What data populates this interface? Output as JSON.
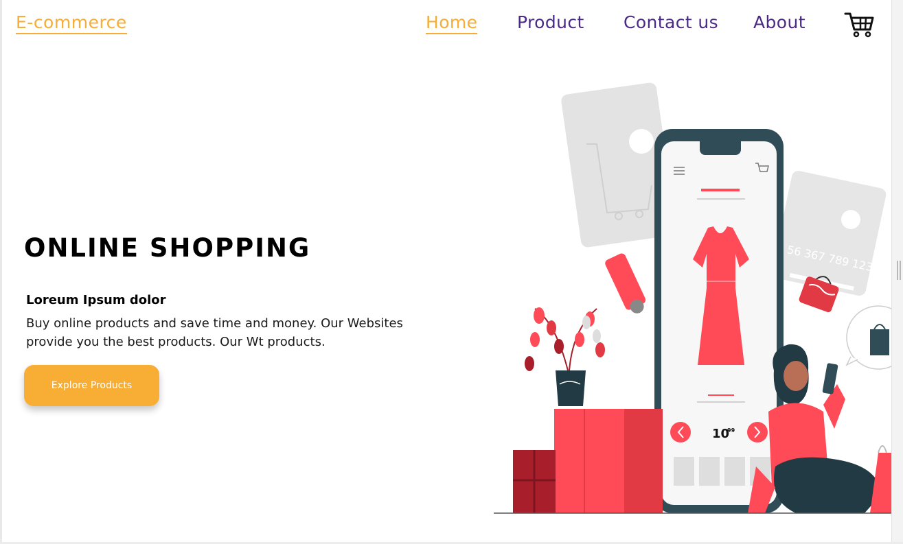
{
  "header": {
    "brand": "E-commerce",
    "nav": [
      {
        "label": "Home",
        "active": true
      },
      {
        "label": "Product",
        "active": false
      },
      {
        "label": "Contact us",
        "active": false
      },
      {
        "label": "About",
        "active": false
      }
    ],
    "cart_icon": "cart-icon"
  },
  "hero": {
    "title": "ONLINE SHOPPING",
    "subtitle": "Loreum Ipsum dolor",
    "description": "Buy online products and save time and money. Our Websites provide you the best products. Our Wt products.",
    "cta_label": "Explore Products"
  },
  "illustration": {
    "card_number": "56 367 789 123",
    "price_main": "10",
    "price_cents": "99"
  },
  "colors": {
    "brand": "#f5ad38",
    "nav": "#4a2a86",
    "accent_red": "#ff4b57",
    "dark_teal": "#2d4a55"
  }
}
